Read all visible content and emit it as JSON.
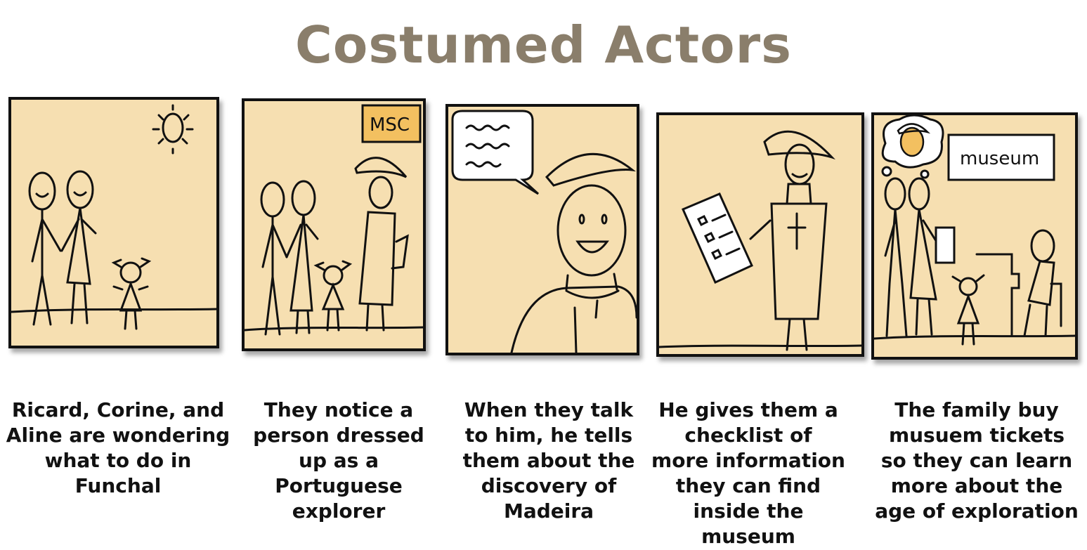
{
  "colors": {
    "title": "#8a7e6b",
    "panel_fill": "#f6dfb1",
    "sign_fill": "#f3c060",
    "ink": "#111111"
  },
  "title": "Costumed Actors",
  "panels": [
    {
      "caption": "Ricard, Corine, and\nAline are wondering\nwhat to do in\nFunchal"
    },
    {
      "caption": "They notice a\nperson dressed\nup as a Portuguese\nexplorer",
      "sign": "MSC"
    },
    {
      "caption": "When they talk\nto him, he tells\nthem about the\ndiscovery of\nMadeira"
    },
    {
      "caption": "He gives them a\nchecklist of\nmore information\nthey can find\ninside the museum"
    },
    {
      "caption": "The family buy\nmusuem tickets\nso they can learn\nmore about the\nage of exploration",
      "sign": "museum"
    }
  ]
}
